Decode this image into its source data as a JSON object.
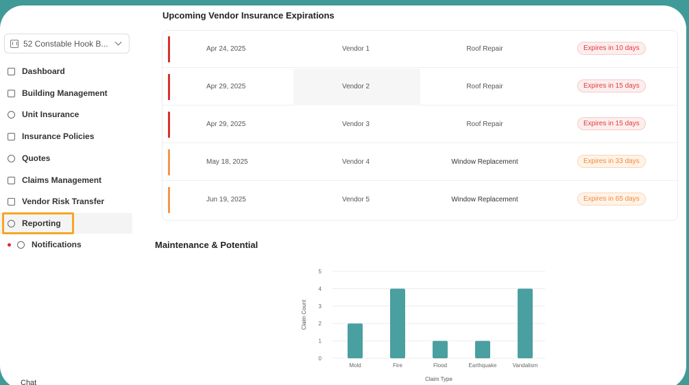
{
  "sidebar": {
    "building": "52 Constable Hook B...",
    "items": [
      {
        "label": "Dashboard"
      },
      {
        "label": "Building Management"
      },
      {
        "label": "Unit Insurance"
      },
      {
        "label": "Insurance Policies"
      },
      {
        "label": "Quotes"
      },
      {
        "label": "Claims Management"
      },
      {
        "label": "Vendor Risk Transfer"
      },
      {
        "label": "Reporting"
      },
      {
        "label": "Notifications"
      }
    ],
    "chat": "Chat"
  },
  "vendor_section": {
    "title": "Upcoming Vendor Insurance Expirations",
    "rows": [
      {
        "date": "Apr 24, 2025",
        "vendor": "Vendor 1",
        "work": "Roof Repair",
        "status": "Expires in 10 days",
        "level": "red"
      },
      {
        "date": "Apr 29, 2025",
        "vendor": "Vendor 2",
        "work": "Roof Repair",
        "status": "Expires in 15 days",
        "level": "red"
      },
      {
        "date": "Apr 29, 2025",
        "vendor": "Vendor 3",
        "work": "Roof Repair",
        "status": "Expires in 15 days",
        "level": "red"
      },
      {
        "date": "May 18, 2025",
        "vendor": "Vendor 4",
        "work": "Window Replacement",
        "status": "Expires in 33 days",
        "level": "orange"
      },
      {
        "date": "Jun 19, 2025",
        "vendor": "Vendor 5",
        "work": "Window Replacement",
        "status": "Expires in 65 days",
        "level": "orange"
      }
    ]
  },
  "maintenance": {
    "title": "Maintenance & Potential"
  },
  "colors": {
    "accent": "#4a9fa0",
    "red": "#d9302c",
    "orange": "#f3964f"
  },
  "chart_data": {
    "type": "bar",
    "categories": [
      "Mold",
      "Fire",
      "Flood",
      "Earthquake",
      "Vandalism"
    ],
    "values": [
      2,
      4,
      1,
      1,
      4
    ],
    "xlabel": "Claim Type",
    "ylabel": "Claim Count",
    "ylim": [
      0,
      5
    ],
    "yticks": [
      0,
      1,
      2,
      3,
      4,
      5
    ],
    "grid": true
  }
}
